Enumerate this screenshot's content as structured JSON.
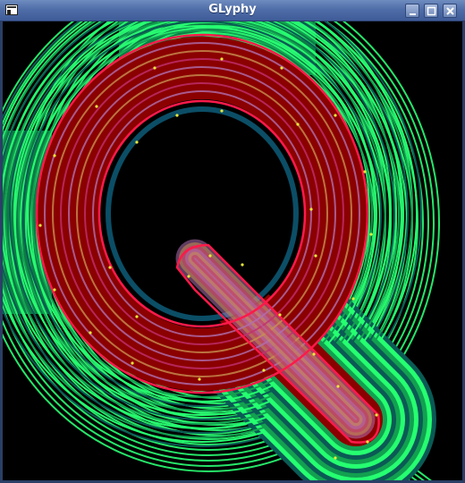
{
  "window": {
    "title": "GLyphy",
    "app_icon": "window-menu-icon",
    "controls": [
      "minimize-icon",
      "maximize-icon",
      "close-icon"
    ]
  },
  "viewport": {
    "glyph": "Q",
    "background_color": "#000000",
    "outline_color": "#ff1a4a",
    "point_color": "#e8e83a",
    "fill_color": "#8b0000",
    "inner_band_colors": [
      "#c03070",
      "#b06fb0",
      "#c89050"
    ],
    "outer_band_colors": [
      "#0a5a55",
      "#12a050",
      "#25ff70"
    ]
  }
}
